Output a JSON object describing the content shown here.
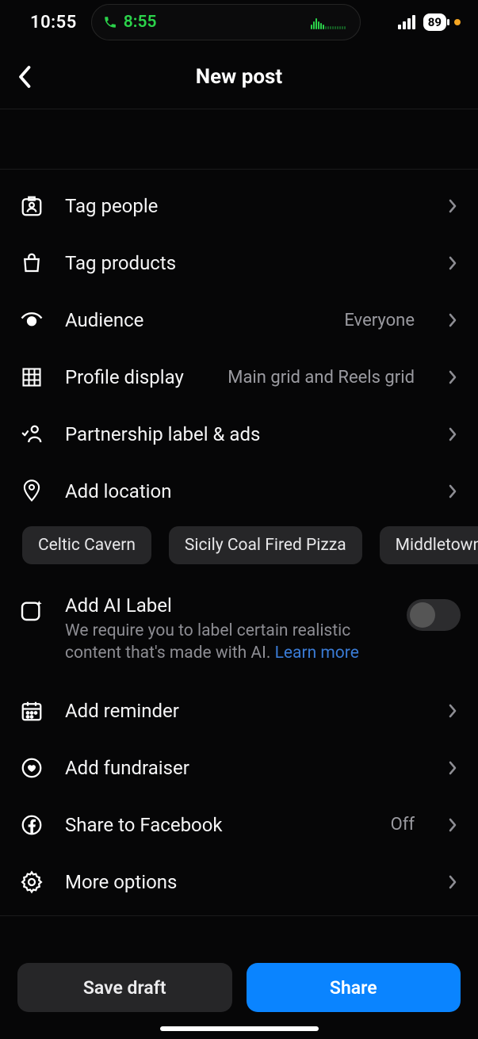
{
  "statusBar": {
    "time": "10:55",
    "callTime": "8:55",
    "battery": "89"
  },
  "header": {
    "title": "New post"
  },
  "rows": {
    "tagPeople": "Tag people",
    "tagProducts": "Tag products",
    "audience": {
      "label": "Audience",
      "value": "Everyone"
    },
    "profileDisplay": {
      "label": "Profile display",
      "value": "Main grid and Reels grid"
    },
    "partnership": "Partnership label & ads",
    "addLocation": "Add location",
    "addReminder": "Add reminder",
    "addFundraiser": "Add fundraiser",
    "shareFacebook": {
      "label": "Share to Facebook",
      "value": "Off"
    },
    "moreOptions": "More options"
  },
  "locationChips": [
    "Celtic Cavern",
    "Sicily Coal Fired Pizza",
    "Middletown, C"
  ],
  "aiLabel": {
    "title": "Add AI Label",
    "desc": "We require you to label certain realistic content that's made with AI. ",
    "link": "Learn more"
  },
  "buttons": {
    "draft": "Save draft",
    "share": "Share"
  }
}
